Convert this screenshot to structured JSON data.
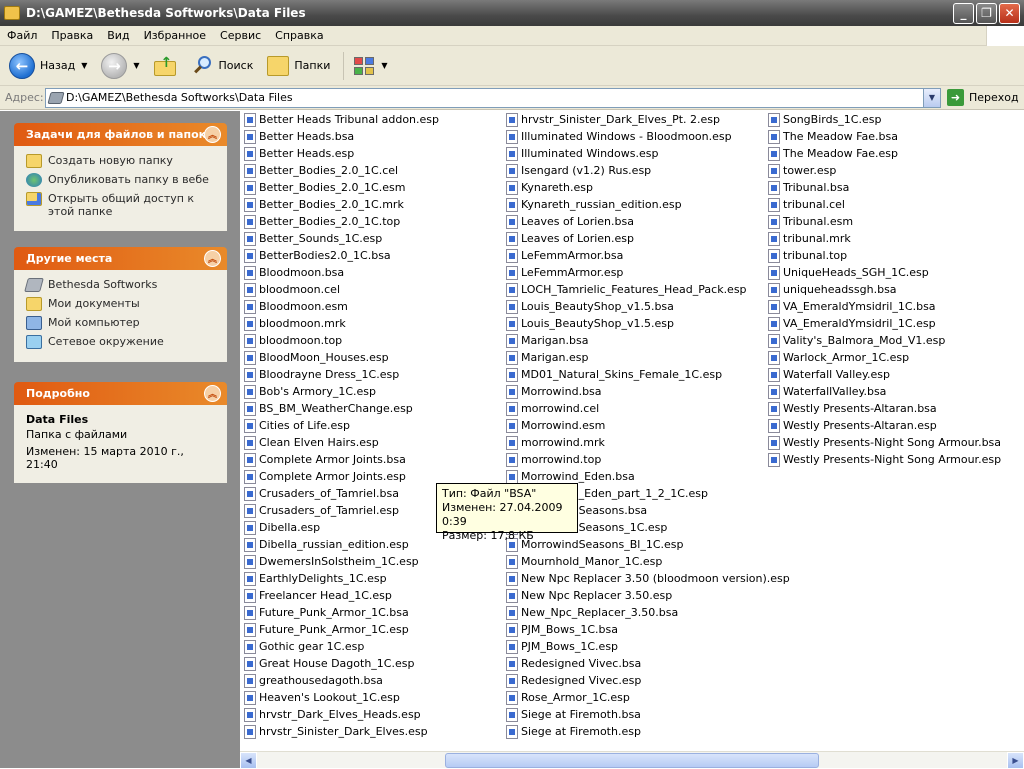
{
  "window": {
    "title": "D:\\GAMEZ\\Bethesda Softworks\\Data Files"
  },
  "menu": [
    "Файл",
    "Правка",
    "Вид",
    "Избранное",
    "Сервис",
    "Справка"
  ],
  "toolbar": {
    "back_label": "Назад",
    "search_label": "Поиск",
    "folders_label": "Папки"
  },
  "address": {
    "label": "Адрес:",
    "value": "D:\\GAMEZ\\Bethesda Softworks\\Data Files",
    "go_label": "Переход"
  },
  "tasks_panel": {
    "title": "Задачи для файлов и папок",
    "items": [
      {
        "label": "Создать новую папку",
        "icon": "new-folder-icon"
      },
      {
        "label": "Опубликовать папку в вебе",
        "icon": "web-publish-icon"
      },
      {
        "label": "Открыть общий доступ к этой папке",
        "icon": "share-folder-icon"
      }
    ]
  },
  "places_panel": {
    "title": "Другие места",
    "items": [
      {
        "label": "Bethesda Softworks",
        "icon": "drive-icon"
      },
      {
        "label": "Мои документы",
        "icon": "my-documents-icon"
      },
      {
        "label": "Мой компьютер",
        "icon": "my-computer-icon"
      },
      {
        "label": "Сетевое окружение",
        "icon": "network-icon"
      }
    ]
  },
  "details_panel": {
    "title": "Подробно",
    "name": "Data Files",
    "type": "Папка с файлами",
    "modified": "Изменен: 15 марта 2010 г., 21:40"
  },
  "files": {
    "col1": [
      "Better Heads Tribunal addon.esp",
      "Better Heads.bsa",
      "Better Heads.esp",
      "Better_Bodies_2.0_1C.cel",
      "Better_Bodies_2.0_1C.esm",
      "Better_Bodies_2.0_1C.mrk",
      "Better_Bodies_2.0_1C.top",
      "Better_Sounds_1C.esp",
      "BetterBodies2.0_1C.bsa",
      "Bloodmoon.bsa",
      "bloodmoon.cel",
      "Bloodmoon.esm",
      "bloodmoon.mrk",
      "bloodmoon.top",
      "BloodMoon_Houses.esp",
      "Bloodrayne Dress_1C.esp",
      "Bob's Armory_1C.esp",
      "BS_BM_WeatherChange.esp",
      "Cities of Life.esp",
      "Clean Elven Hairs.esp",
      "Complete Armor Joints.bsa",
      "Complete Armor Joints.esp",
      "Crusaders_of_Tamriel.bsa",
      "Crusaders_of_Tamriel.esp",
      "Dibella.esp",
      "Dibella_russian_edition.esp",
      "DwemersInSolstheim_1C.esp",
      "EarthlyDelights_1C.esp",
      "Freelancer Head_1C.esp",
      "Future_Punk_Armor_1C.bsa",
      "Future_Punk_Armor_1C.esp",
      "Gothic gear 1C.esp",
      "Great House Dagoth_1C.esp",
      "greathousedagoth.bsa",
      "Heaven's Lookout_1C.esp",
      "hrvstr_Dark_Elves_Heads.esp",
      "hrvstr_Sinister_Dark_Elves.esp"
    ],
    "col2": [
      "hrvstr_Sinister_Dark_Elves_Pt. 2.esp",
      "Illuminated Windows - Bloodmoon.esp",
      "Illuminated Windows.esp",
      "Isengard (v1.2) Rus.esp",
      "Kynareth.esp",
      "Kynareth_russian_edition.esp",
      "Leaves of Lorien.bsa",
      "Leaves of Lorien.esp",
      "LeFemmArmor.bsa",
      "LeFemmArmor.esp",
      "LOCH_Tamrielic_Features_Head_Pack.esp",
      "Louis_BeautyShop_v1.5.bsa",
      "Louis_BeautyShop_v1.5.esp",
      "Marigan.bsa",
      "Marigan.esp",
      "MD01_Natural_Skins_Female_1C.esp",
      "Morrowind.bsa",
      "morrowind.cel",
      "Morrowind.esm",
      "morrowind.mrk",
      "morrowind.top",
      "Morrowind_Eden.bsa",
      "Morrowind_Eden_part_1_2_1C.esp",
      "MorrowindSeasons.bsa",
      "MorrowindSeasons_1C.esp",
      "MorrowindSeasons_Bl_1C.esp",
      "Mournhold_Manor_1C.esp",
      "New Npc Replacer 3.50 (bloodmoon version).esp",
      "New Npc Replacer 3.50.esp",
      "New_Npc_Replacer_3.50.bsa",
      "PJM_Bows_1C.bsa",
      "PJM_Bows_1C.esp",
      "Redesigned Vivec.bsa",
      "Redesigned Vivec.esp",
      "Rose_Armor_1C.esp",
      "Siege at Firemoth.bsa",
      "Siege at Firemoth.esp"
    ],
    "col3": [
      "SongBirds_1C.esp",
      "The Meadow Fae.bsa",
      "The Meadow Fae.esp",
      "tower.esp",
      "Tribunal.bsa",
      "tribunal.cel",
      "Tribunal.esm",
      "tribunal.mrk",
      "tribunal.top",
      "UniqueHeads_SGH_1C.esp",
      "uniqueheadssgh.bsa",
      "VA_EmeraldYmsidril_1C.bsa",
      "VA_EmeraldYmsidril_1C.esp",
      "Vality's_Balmora_Mod_V1.esp",
      "Warlock_Armor_1C.esp",
      "Waterfall Valley.esp",
      "WaterfallValley.bsa",
      "Westly Presents-Altaran.bsa",
      "Westly Presents-Altaran.esp",
      "Westly Presents-Night Song Armour.bsa",
      "Westly Presents-Night Song Armour.esp"
    ]
  },
  "tooltip": {
    "type": "Тип: Файл \"BSA\"",
    "modified": "Изменен: 27.04.2009 0:39",
    "size": "Размер: 17,8 КБ"
  },
  "colors": {
    "panel_header": "#e05a12",
    "taskpane_bg": "#8c8c8c",
    "tooltip_bg": "#ffffe1"
  }
}
